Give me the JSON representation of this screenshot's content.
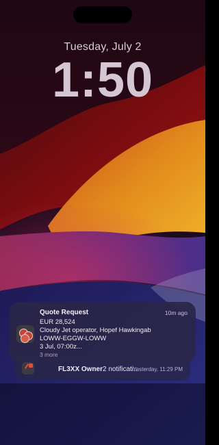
{
  "lockscreen": {
    "date": "Tuesday, July 2",
    "time": "1:50"
  },
  "notifications": {
    "front": {
      "title": "Quote Request",
      "time": "10m ago",
      "lines": [
        "EUR 28,524",
        "Cloudy Jet operator, Hopef Hawkingab",
        "LOWW-EGGW-LOWW",
        "3 Jul, 07:00z..."
      ],
      "more": "3 more",
      "icon": "coins-icon"
    },
    "back": {
      "title": "FL3XX Owner",
      "summary": "2 notificati...",
      "time": "Yesterday, 11:29 PM",
      "icon": "fl3xx-app-icon"
    }
  },
  "colors": {
    "wallpaper_dark": "#1a0616",
    "wallpaper_red": "#8b0f12",
    "wallpaper_orange": "#e7a018",
    "wallpaper_purple": "#6a2a8a",
    "wallpaper_blue": "#3a2f8c",
    "accent_red": "#e34b3a"
  }
}
